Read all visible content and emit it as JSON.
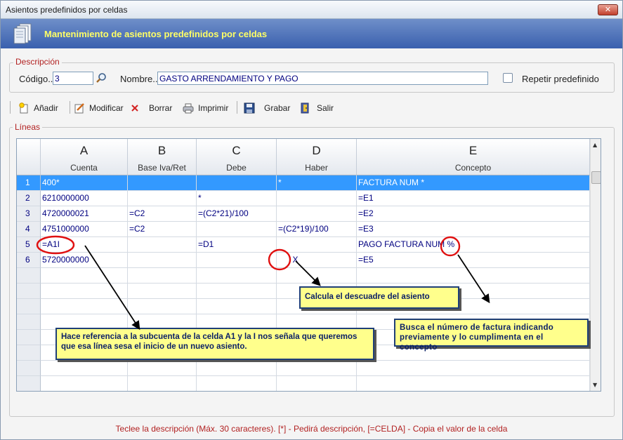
{
  "window": {
    "title": "Asientos predefinidos por celdas",
    "close_glyph": "✕"
  },
  "banner": {
    "title": "Mantenimiento de asientos predefinidos por celdas",
    "icon": "documents-icon"
  },
  "descripcion": {
    "legend": "Descripción",
    "codigo_label": "Código..",
    "codigo_value": "3",
    "nombre_label": "Nombre..",
    "nombre_value": "GASTO ARRENDAMIENTO Y PAGO",
    "repetir_label": "Repetir predefinido",
    "repetir_checked": false
  },
  "toolbar": {
    "anadir": "Añadir",
    "modificar": "Modificar",
    "borrar": "Borrar",
    "imprimir": "Imprimir",
    "grabar": "Grabar",
    "salir": "Salir"
  },
  "lineas": {
    "legend": "Líneas",
    "columns": [
      {
        "letter": "A",
        "label": "Cuenta"
      },
      {
        "letter": "B",
        "label": "Base Iva/Ret"
      },
      {
        "letter": "C",
        "label": "Debe"
      },
      {
        "letter": "D",
        "label": "Haber"
      },
      {
        "letter": "E",
        "label": "Concepto"
      }
    ],
    "rows": [
      {
        "n": "1",
        "a": "400*",
        "b": "",
        "c": "",
        "d": "*",
        "e": "FACTURA NUM *"
      },
      {
        "n": "2",
        "a": "6210000000",
        "b": "",
        "c": "*",
        "d": "",
        "e": "=E1"
      },
      {
        "n": "3",
        "a": "4720000021",
        "b": "=C2",
        "c": "=(C2*21)/100",
        "d": "",
        "e": "=E2"
      },
      {
        "n": "4",
        "a": "4751000000",
        "b": "=C2",
        "c": "",
        "d": "=(C2*19)/100",
        "e": "=E3"
      },
      {
        "n": "5",
        "a": "=A1I",
        "b": "",
        "c": "=D1",
        "d": "",
        "e": "PAGO FACTURA NUM %"
      },
      {
        "n": "6",
        "a": "5720000000",
        "b": "",
        "c": "",
        "d": "X",
        "e": "=E5"
      }
    ],
    "selected_row": 1
  },
  "notes": {
    "descuadre": "Calcula el descuadre del asiento",
    "referencia": "Hace referencia a la subcuenta de la celda A1 y la I nos señala que queremos que esa línea sesa el inicio de un nuevo asiento.",
    "factura": "Busca el número de factura indicando previamente y lo cumplimenta en el concepto"
  },
  "status": "Teclee la descripción (Máx. 30 caracteres). [*] - Pedirá descripción, [=CELDA] - Copia el valor de la celda",
  "colors": {
    "accent": "#3399ff",
    "banner": "#4a6fb8",
    "legend": "#b22222",
    "note_bg": "#ffff8c"
  }
}
